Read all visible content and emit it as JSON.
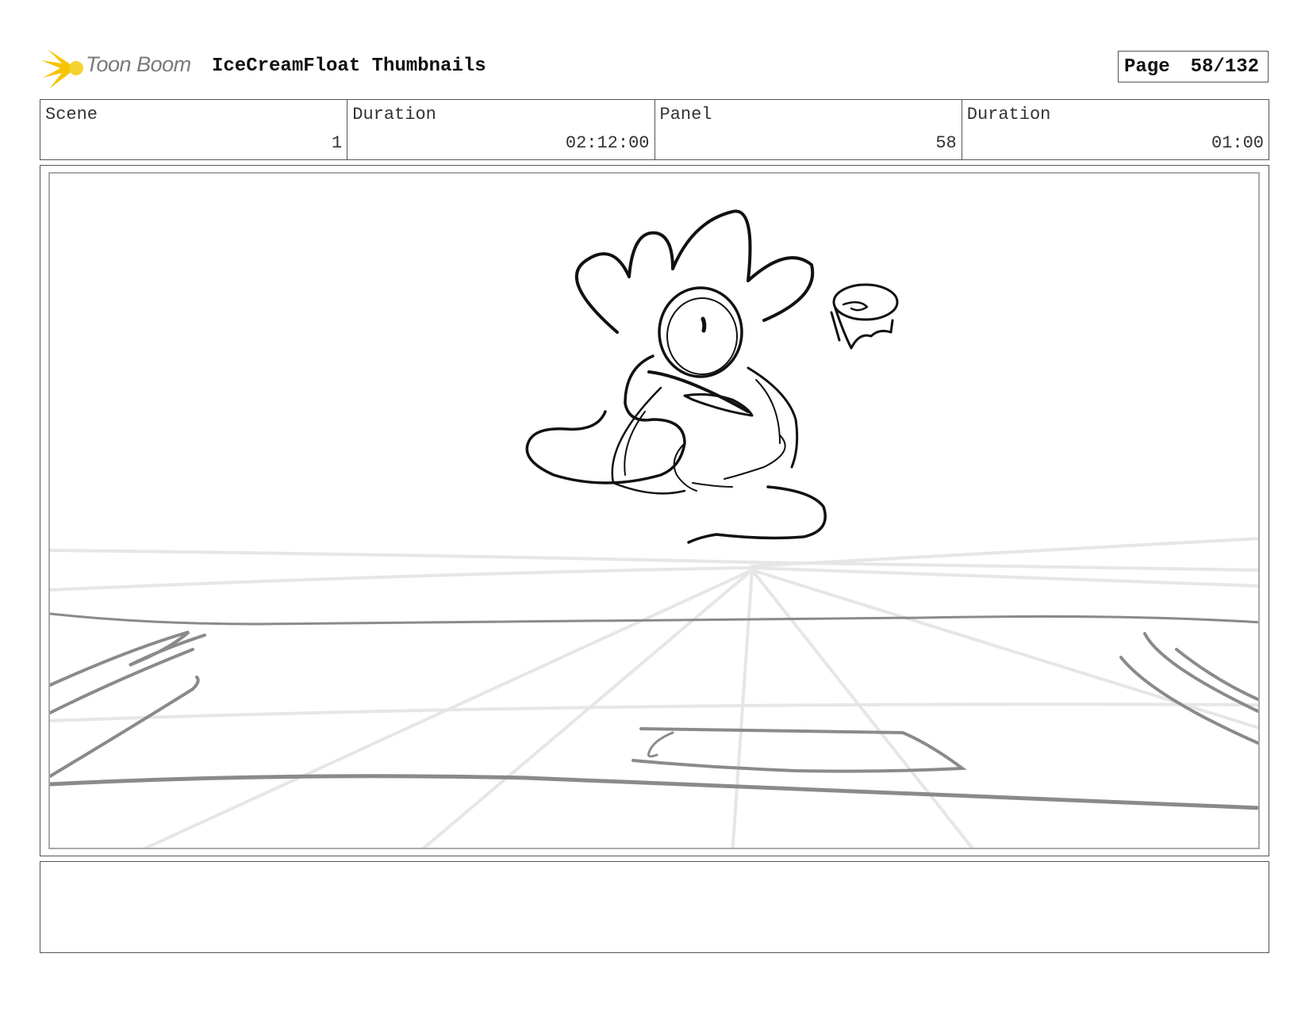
{
  "header": {
    "logo_text": "Toon Boom",
    "title": "IceCreamFloat Thumbnails",
    "page_label": "Page",
    "page_value": "58/132"
  },
  "info": {
    "scene_label": "Scene",
    "scene_value": "1",
    "scene_duration_label": "Duration",
    "scene_duration_value": "02:12:00",
    "panel_label": "Panel",
    "panel_value": "58",
    "panel_duration_label": "Duration",
    "panel_duration_value": "01:00"
  },
  "colors": {
    "logo_accent": "#f5c400",
    "logo_text": "#7a7a7a",
    "border": "#555555",
    "sketch_ink": "#111111"
  },
  "icons": {
    "logo": "toon-boom-starburst-icon"
  },
  "notes": {
    "text": ""
  }
}
